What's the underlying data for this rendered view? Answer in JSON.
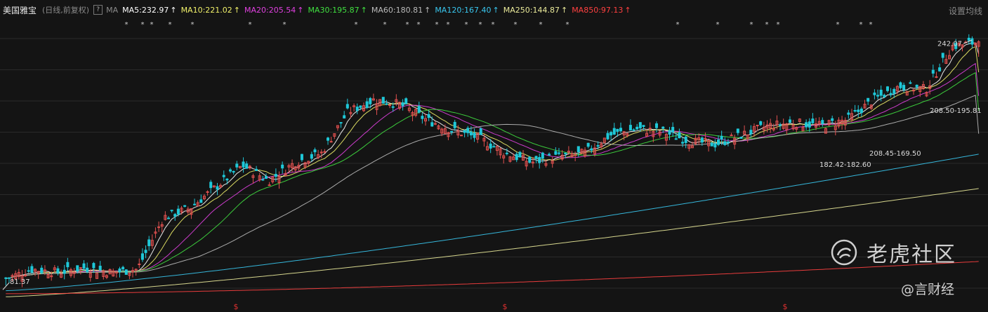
{
  "legend": {
    "stock_name": "美国雅宝",
    "mode": "(日线,前复权)",
    "help": "?",
    "ma_label": "MA",
    "settings": "设置均线"
  },
  "moving_averages": [
    {
      "label": "MA5:232.97",
      "color": "#ffffff",
      "arrow": "↑"
    },
    {
      "label": "MA10:221.02",
      "color": "#f0f06a",
      "arrow": "↑"
    },
    {
      "label": "MA20:205.54",
      "color": "#e040e0",
      "arrow": "↑"
    },
    {
      "label": "MA30:195.87",
      "color": "#40e040",
      "arrow": "↑"
    },
    {
      "label": "MA60:180.81",
      "color": "#bbbbbb",
      "arrow": "↑"
    },
    {
      "label": "MA120:167.40",
      "color": "#39c6ee",
      "arrow": "↑"
    },
    {
      "label": "MA250:144.87",
      "color": "#eaea9a",
      "arrow": "↑"
    },
    {
      "label": "MA850:97.13",
      "color": "#ff4040",
      "arrow": "↑"
    }
  ],
  "annotations": {
    "high": "242.07",
    "low": "81.37",
    "range_1": "208.50-195.81",
    "range_2": "208.45-169.50",
    "range_3": "182.42-182.60",
    "dividend_marker": "$"
  },
  "watermark": {
    "brand": "老虎社区",
    "credit": "@言财经"
  },
  "colors": {
    "up": "#e0504f",
    "down": "#1fc8d8",
    "background": "#141414",
    "grid": "#2a2a2a"
  },
  "chart_data": {
    "type": "candlestick",
    "title": "美国雅宝",
    "x": "trading days",
    "ylim": [
      70,
      250
    ],
    "ohlc_keyframes": [
      [
        84,
        82,
        88,
        81.37,
        86
      ],
      [
        92,
        86,
        96,
        85,
        92
      ],
      [
        92,
        88,
        96,
        86,
        90
      ],
      [
        96,
        88,
        98,
        86,
        93
      ],
      [
        88,
        93,
        95,
        87,
        90
      ],
      [
        91,
        90,
        95,
        88,
        92
      ],
      [
        124,
        92,
        128,
        91,
        126
      ],
      [
        130,
        126,
        135,
        120,
        132
      ],
      [
        148,
        132,
        150,
        128,
        146
      ],
      [
        158,
        146,
        162,
        144,
        160
      ],
      [
        145,
        160,
        163,
        140,
        150
      ],
      [
        163,
        150,
        165,
        148,
        162
      ],
      [
        165,
        162,
        170,
        160,
        168
      ],
      [
        190,
        168,
        198,
        166,
        195
      ],
      [
        200,
        195,
        206,
        190,
        203
      ],
      [
        198,
        203,
        210,
        195,
        200
      ],
      [
        193,
        200,
        204,
        188,
        190
      ],
      [
        175,
        190,
        198,
        170,
        183
      ],
      [
        168,
        183,
        188,
        162,
        178
      ],
      [
        164,
        178,
        182,
        158,
        168
      ],
      [
        157,
        168,
        172,
        154,
        162
      ],
      [
        164,
        162,
        170,
        160,
        166
      ],
      [
        165,
        166,
        170,
        162,
        168
      ],
      [
        178,
        168,
        184,
        166,
        180
      ],
      [
        187,
        180,
        190,
        176,
        184
      ],
      [
        185,
        184,
        188,
        178,
        182
      ],
      [
        178,
        182,
        186,
        172,
        176
      ],
      [
        176,
        176,
        180,
        172,
        174
      ],
      [
        182,
        174,
        185,
        172,
        180
      ],
      [
        188,
        180,
        192,
        178,
        186
      ],
      [
        187,
        186,
        193,
        183,
        188
      ],
      [
        186,
        188,
        192,
        184,
        186
      ],
      [
        190,
        186,
        194,
        184,
        190
      ],
      [
        200,
        190,
        206,
        188,
        203
      ],
      [
        215,
        203,
        220,
        200,
        212
      ],
      [
        210,
        212,
        218,
        205,
        210
      ],
      [
        238,
        215,
        240,
        208,
        238
      ],
      [
        242,
        238,
        242.07,
        236,
        241
      ]
    ],
    "moving_averages": [
      "MA5",
      "MA10",
      "MA20",
      "MA30",
      "MA60",
      "MA120",
      "MA250",
      "MA850"
    ],
    "ma_last_values": [
      232.97,
      221.02,
      205.54,
      195.87,
      180.81,
      167.4,
      144.87,
      97.13
    ]
  }
}
